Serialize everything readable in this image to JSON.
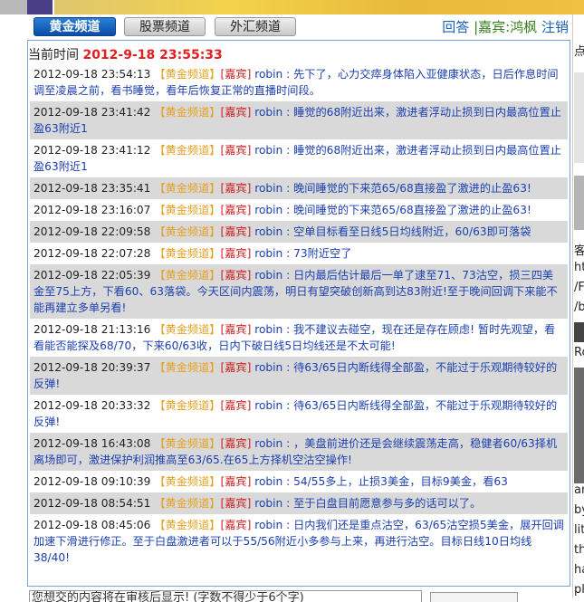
{
  "tabs": [
    {
      "label": "黄金频道",
      "active": true
    },
    {
      "label": "股票频道",
      "active": false
    },
    {
      "label": "外汇频道",
      "active": false
    }
  ],
  "toplinks": {
    "answer": "回答",
    "guest_prefix": "|嘉宾:",
    "guest_name": "鸿枫",
    "logout": "注销"
  },
  "timebar": {
    "label": "当前时间",
    "value": "2012-9-18 23:55:33"
  },
  "messages": [
    {
      "time": "2012-09-18 23:54:13",
      "channel": "【黄金频道】",
      "role": "[嘉宾]",
      "name": "robin :",
      "text": "先下了，心力交瘁身体陷入亚健康状态，日后作息时间调至凌晨之前，看书睡觉，看年后恢复正常的直播时间段。"
    },
    {
      "time": "2012-09-18 23:41:42",
      "channel": "【黄金频道】",
      "role": "[嘉宾]",
      "name": "robin :",
      "text": "睡觉的68附近出来，激进者浮动止损到日内最高位置止盈63附近1"
    },
    {
      "time": "2012-09-18 23:41:12",
      "channel": "【黄金频道】",
      "role": "[嘉宾]",
      "name": "robin :",
      "text": "睡觉的68附近出来，激进者浮动止损到日内最高位置止盈63附近1"
    },
    {
      "time": "2012-09-18 23:35:41",
      "channel": "【黄金频道】",
      "role": "[嘉宾]",
      "name": "robin :",
      "text": "晚间睡觉的下来范65/68直接盈了激进的止盈63!"
    },
    {
      "time": "2012-09-18 23:16:07",
      "channel": "【黄金频道】",
      "role": "[嘉宾]",
      "name": "robin :",
      "text": "晚间睡觉的下来范65/68直接盈了激进的止盈63!"
    },
    {
      "time": "2012-09-18 22:09:58",
      "channel": "【黄金频道】",
      "role": "[嘉宾]",
      "name": "robin :",
      "text": "空单目标看至日线5日均线附近，60/63即可落袋"
    },
    {
      "time": "2012-09-18 22:07:28",
      "channel": "【黄金频道】",
      "role": "[嘉宾]",
      "name": "robin :",
      "text": "73附近空了"
    },
    {
      "time": "2012-09-18 22:05:39",
      "channel": "【黄金频道】",
      "role": "[嘉宾]",
      "name": "robin :",
      "text": "日内最后估计最后一单了逮至71、73沽空，损三四美金至75上方，下看60、63落袋。今天区间内震荡，明日有望突破创新高到达83附近!至于晚间回调下来能不能再建立多单另看!"
    },
    {
      "time": "2012-09-18 21:13:16",
      "channel": "【黄金频道】",
      "role": "[嘉宾]",
      "name": "robin :",
      "text": "我不建议去碰空，现在还是存在顾虑! 暂时先观望，看看能否能探及68/70，下来60/63收，日内下破日线5日均线还是不太可能!"
    },
    {
      "time": "2012-09-18 20:39:37",
      "channel": "【黄金频道】",
      "role": "[嘉宾]",
      "name": "robin :",
      "text": "待63/65日内断线得全部盈，不能过于乐观期待较好的反弹!"
    },
    {
      "time": "2012-09-18 20:33:32",
      "channel": "【黄金频道】",
      "role": "[嘉宾]",
      "name": "robin :",
      "text": "待63/65日内断线得全部盈，不能过于乐观期待较好的反弹!"
    },
    {
      "time": "2012-09-18 16:43:08",
      "channel": "【黄金频道】",
      "role": "[嘉宾]",
      "name": "robin :",
      "text": "，美盘前进价还是会继续震荡走高，稳健者60/63择机离场即可，激进保护利润推高至63/65.在65上方择机空沽空操作!"
    },
    {
      "time": "2012-09-18 09:10:39",
      "channel": "【黄金频道】",
      "role": "[嘉宾]",
      "name": "robin :",
      "text": "54/55多上，止损3美金，目标9美金，看63"
    },
    {
      "time": "2012-09-18 08:54:51",
      "channel": "【黄金频道】",
      "role": "[嘉宾]",
      "name": "robin :",
      "text": "至于白盘目前愿意参与多的话可以了。"
    },
    {
      "time": "2012-09-18 08:45:06",
      "channel": "【黄金频道】",
      "role": "[嘉宾]",
      "name": "robin :",
      "text": "日内我们还是重点沽空，63/65沽空损5美金，展开回调加速下滑进行修正。至于白盘激进者可以于55/56附近小多参与上来，再进行沽空。目标日线10日均线38/40!"
    }
  ],
  "bottom": {
    "hint": "您想交的内容将在审核后显示! (字数不得少于6个字)"
  },
  "right_sidebar": {
    "fragments": [
      "点",
      "客",
      "ht",
      "/F",
      "/b",
      "Ro",
      "ar",
      "by",
      "litt",
      "the",
      "ha",
      "pla"
    ]
  },
  "colors": {
    "active_tab": "#0a4da8",
    "message_text": "#1b3fb0",
    "channel_tag": "#e8a020",
    "guest_tag": "#d02020",
    "current_time": "#e02020",
    "even_row": "#d9d9d9"
  }
}
